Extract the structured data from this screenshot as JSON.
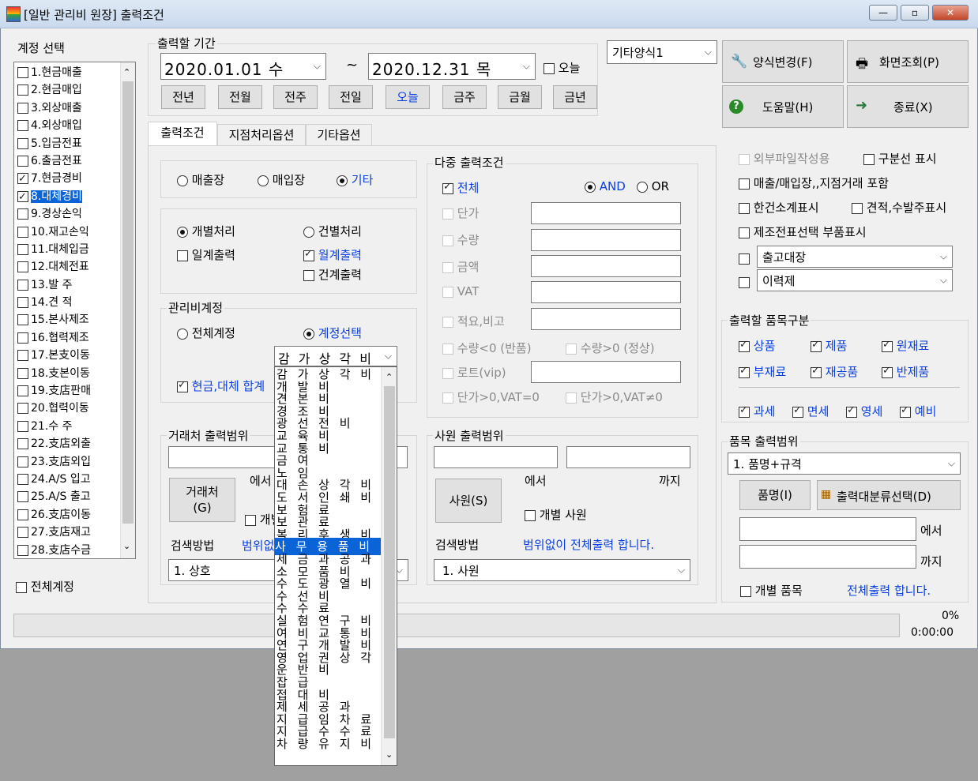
{
  "window": {
    "title": "[일반 관리비 원장] 출력조건",
    "minimize": "▭",
    "maximize": "▫",
    "close": "✕"
  },
  "accounts": {
    "label": "계정 선택",
    "items": [
      {
        "label": "1.현금매출",
        "checked": false
      },
      {
        "label": "2.현금매입",
        "checked": false
      },
      {
        "label": "3.외상매출",
        "checked": false
      },
      {
        "label": "4.외상매입",
        "checked": false
      },
      {
        "label": "5.입금전표",
        "checked": false
      },
      {
        "label": "6.출금전표",
        "checked": false
      },
      {
        "label": "7.현금경비",
        "checked": true
      },
      {
        "label": "8.대체경비",
        "checked": true,
        "selected": true
      },
      {
        "label": "9.경상손익",
        "checked": false
      },
      {
        "label": "10.재고손익",
        "checked": false
      },
      {
        "label": "11.대체입금",
        "checked": false
      },
      {
        "label": "12.대체전표",
        "checked": false
      },
      {
        "label": "13.발  주",
        "checked": false
      },
      {
        "label": "14.견  적",
        "checked": false
      },
      {
        "label": "15.본사제조",
        "checked": false
      },
      {
        "label": "16.협력제조",
        "checked": false
      },
      {
        "label": "17.본支이동",
        "checked": false
      },
      {
        "label": "18.支본이동",
        "checked": false
      },
      {
        "label": "19.支店판매",
        "checked": false
      },
      {
        "label": "20.협력이동",
        "checked": false
      },
      {
        "label": "21.수  주",
        "checked": false
      },
      {
        "label": "22.支店외출",
        "checked": false
      },
      {
        "label": "23.支店외입",
        "checked": false
      },
      {
        "label": "24.A/S 입고",
        "checked": false
      },
      {
        "label": "25.A/S 출고",
        "checked": false
      },
      {
        "label": "26.支店이동",
        "checked": false
      },
      {
        "label": "27.支店재고",
        "checked": false
      },
      {
        "label": "28.支店수금",
        "checked": false
      }
    ],
    "all_label": "전체계정"
  },
  "period": {
    "label": "출력할 기간",
    "from": "2020.01.01  수",
    "tilde": "~",
    "to": "2020.12.31  목",
    "today_label": "오늘",
    "buttons": [
      "전년",
      "전월",
      "전주",
      "전일",
      "오늘",
      "금주",
      "금월",
      "금년"
    ]
  },
  "form_select": {
    "value": "기타양식1"
  },
  "top_buttons": {
    "change_form": "양식변경(F)",
    "screen_view": "화면조회(P)",
    "help": "도움말(H)",
    "exit": "종료(X)"
  },
  "tabs": [
    "출력조건",
    "지점처리옵션",
    "기타옵션"
  ],
  "ledger": {
    "sales": "매출장",
    "purchase": "매입장",
    "other": "기타"
  },
  "processing": {
    "individual": "개별처리",
    "per_case": "건별처리",
    "daily": "일계출력",
    "monthly": "월계출력",
    "per_item": "건계출력"
  },
  "mgmt_account": {
    "label": "관리비계정",
    "all": "전체계정",
    "select": "계정선택",
    "cash_sum": "현금,대체 합계",
    "combo_value": "감 가 상 각 비"
  },
  "dropdown_items": [
    "감 가 상 각 비",
    "개 발 비",
    "견 본 비",
    "경 조 비",
    "광 선 전 비",
    "교 육 비",
    "교 통 비",
    "금 여",
    "노 임",
    "대 손 상 각 비",
    "도 서 인 쇄 비",
    "보 험 료",
    "보 관 료",
    "복 리 후 생 비",
    "사 무 용 품 비",
    "세 금 과 공 과",
    "소 모 품 비",
    "수 도 광 열 비",
    "수 선 비",
    "수 수 료",
    "실 험 연 구 비",
    "여 비 교 통 비",
    "연 구 개 발 비",
    "영 업 권 상 각",
    "운 반 비",
    "잡 급",
    "접 대 비",
    "제 세 공 과",
    "지 급 임 차 료",
    "지 급 수 수 료",
    "차 량 유 지 비"
  ],
  "trade": {
    "label": "거래처 출력범위",
    "from_suffix": "에서",
    "btn": "거래처\n(G)",
    "individual": "개별",
    "search_label": "검색방법",
    "search_note": "범위없",
    "search_value": "1. 상호"
  },
  "multi": {
    "label": "다중 출력조건",
    "all": "전체",
    "and": "AND",
    "or": "OR",
    "unit_price": "단가",
    "qty": "수량",
    "amount": "금액",
    "vat": "VAT",
    "remark": "적요,비고",
    "qty_neg": "수량<0 (반품)",
    "qty_pos": "수량>0 (정상)",
    "lot": "로트(vip)",
    "vat_zero": "단가>0,VAT=0",
    "vat_nonzero": "단가>0,VAT≠0"
  },
  "staff": {
    "label": "사원 출력범위",
    "from_suffix": "에서",
    "to_suffix": "까지",
    "btn": "사원(S)",
    "individual": "개별 사원",
    "search_label": "검색방법",
    "search_note": "범위없이 전체출력 합니다.",
    "search_value": "1. 사원"
  },
  "options": {
    "external_file": "외부파일작성용",
    "divider": "구분선 표시",
    "include_branch": "매출/매입장,,지점거래 포함",
    "subtotal": "한건소계표시",
    "estimate": "견적,수발주표시",
    "manufacture": "제조전표선택 부품표시",
    "combo1": "출고대장",
    "combo2": "이력제"
  },
  "item_class": {
    "label": "출력할 품목구분",
    "goods": "상품",
    "product": "제품",
    "raw": "원재료",
    "sub": "부재료",
    "wip": "재공품",
    "semi": "반제품",
    "tax": "과세",
    "exempt": "면세",
    "zero": "영세",
    "reserve": "예비"
  },
  "item_range": {
    "label": "품목 출력범위",
    "combo": "1. 품명+규격",
    "btn_name": "품명(I)",
    "btn_class": "출력대분류선택(D)",
    "from_suffix": "에서",
    "to_suffix": "까지",
    "individual": "개별 품목",
    "note": "전체출력 합니다."
  },
  "progress": {
    "percent": "0%",
    "time": "0:00:00"
  },
  "colors": {
    "accent": "#0a3fe0",
    "selection": "#0a64d8"
  }
}
